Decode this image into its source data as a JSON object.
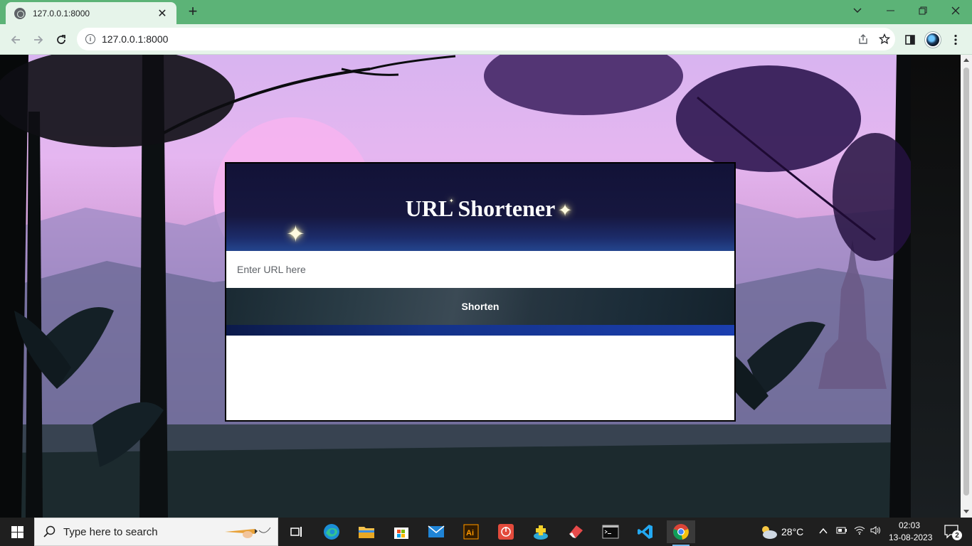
{
  "browser": {
    "tab_title": "127.0.0.1:8000",
    "tab_close": "✕",
    "new_tab": "+",
    "address": "127.0.0.1:8000"
  },
  "page": {
    "title": "URL Shortener",
    "input_placeholder": "Enter URL here",
    "button_label": "Shorten"
  },
  "taskbar": {
    "search_placeholder": "Type here to search",
    "weather_temp": "28°C",
    "time": "02:03",
    "date": "13-08-2023",
    "notification_count": "2"
  },
  "colors": {
    "tab_bar": "#5cb377",
    "toolbar": "#e6f4ea",
    "card_header": "#121237",
    "button_bg": "#263540"
  }
}
